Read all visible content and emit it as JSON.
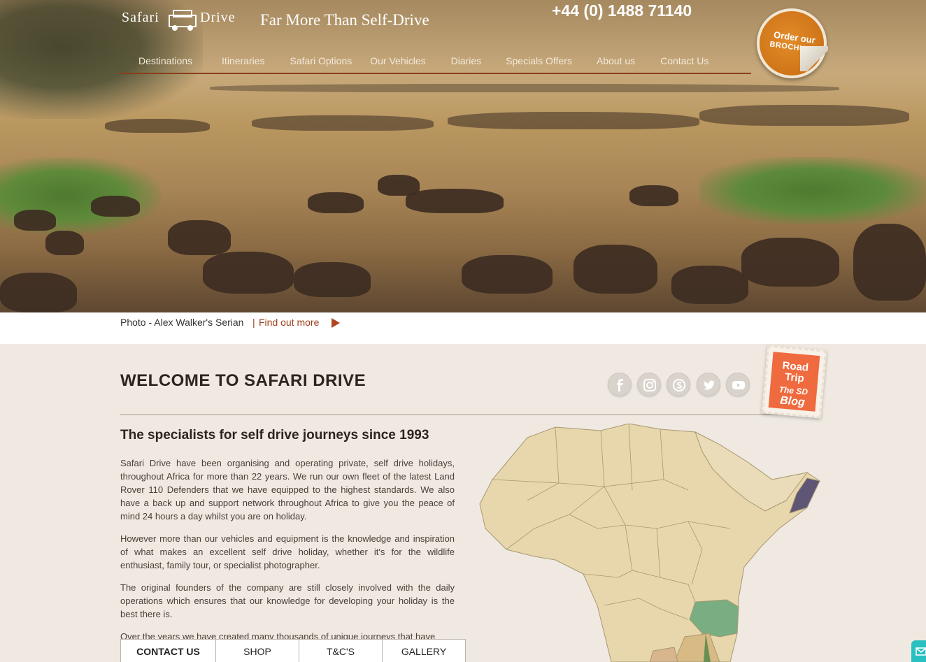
{
  "header": {
    "logo_word_1": "Safari",
    "logo_word_2": "Drive",
    "tagline": "Far More Than Self-Drive",
    "phone": "+44 (0) 1488 71140",
    "brochure_line_1": "Order our",
    "brochure_line_2": "BROCHURE"
  },
  "nav": {
    "items": [
      {
        "label": "Destinations"
      },
      {
        "label": "Itineraries"
      },
      {
        "label": "Safari Options"
      },
      {
        "label": "Our Vehicles"
      },
      {
        "label": "Diaries"
      },
      {
        "label": "Specials Offers"
      },
      {
        "label": "About us"
      },
      {
        "label": "Contact Us"
      }
    ]
  },
  "caption": {
    "credit": "Photo - Alex Walker's Serian",
    "separator": "|",
    "link": "Find out more"
  },
  "main": {
    "title": "WELCOME TO SAFARI DRIVE",
    "subtitle": "The specialists for self drive journeys since 1993",
    "paragraphs": [
      "Safari Drive have been organising and operating private, self drive holidays, throughout Africa for more than 22 years. We run our own fleet of the latest Land Rover 110 Defenders that we have equipped to the highest standards. We also have a back up and support network throughout Africa to give you the peace of mind 24 hours a day whilst you are on holiday.",
      "However more than our vehicles and equipment is the knowledge and inspiration of what makes an excellent self drive holiday, whether it's for the wildlife enthusiast, family tour, or specialist photographer.",
      "The original founders of the company are still closely involved with the daily operations which ensures that our knowledge for developing your holiday is the best there is.",
      "Over the years we have created many thousands of unique journeys that have"
    ]
  },
  "social": [
    {
      "icon": "facebook-icon"
    },
    {
      "icon": "instagram-icon"
    },
    {
      "icon": "skype-icon"
    },
    {
      "icon": "twitter-icon"
    },
    {
      "icon": "youtube-icon"
    }
  ],
  "blog_stamp": {
    "line1": "Road",
    "line2": "Trip",
    "line3": "The SD",
    "line4": "Blog"
  },
  "bottom_tabs": [
    {
      "label": "CONTACT US"
    },
    {
      "label": "SHOP"
    },
    {
      "label": "T&C'S"
    },
    {
      "label": "GALLERY"
    }
  ],
  "colors": {
    "accent": "#9c3d1a",
    "brochure": "#cf7518",
    "stamp": "#ef6a3e",
    "map_land": "#e6d3a8",
    "map_highlight": "#6fa37a"
  }
}
